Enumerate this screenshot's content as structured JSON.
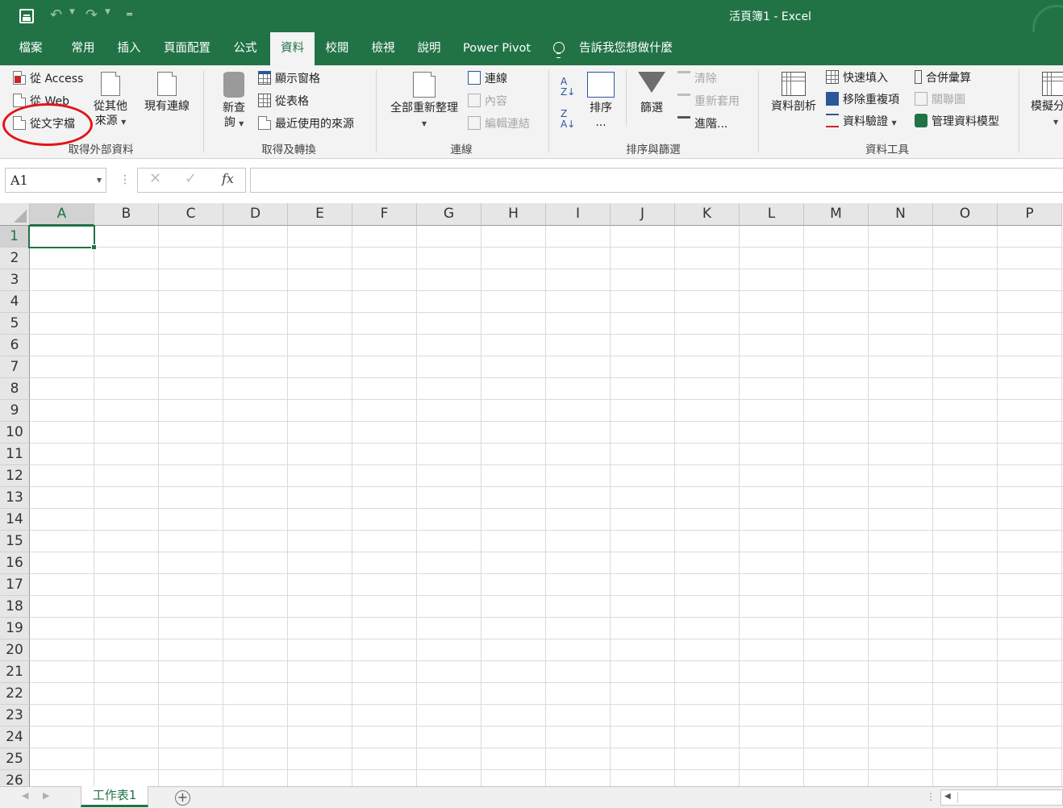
{
  "window": {
    "title": "活頁簿1  -  Excel"
  },
  "qat": {
    "save_icon": "save-icon",
    "undo_icon": "undo-icon",
    "redo_icon": "redo-icon",
    "customize": "="
  },
  "tabs": [
    {
      "label": "檔案"
    },
    {
      "label": "常用"
    },
    {
      "label": "插入"
    },
    {
      "label": "頁面配置"
    },
    {
      "label": "公式"
    },
    {
      "label": "資料",
      "active": true
    },
    {
      "label": "校閱"
    },
    {
      "label": "檢視"
    },
    {
      "label": "說明"
    },
    {
      "label": "Power Pivot"
    }
  ],
  "tell_me": "告訴我您想做什麼",
  "ribbon": {
    "ext": {
      "from_access": "從 Access",
      "from_web": "從 Web",
      "from_text": "從文字檔",
      "from_other_1": "從其他",
      "from_other_2": "來源",
      "existing": "現有連線",
      "label": "取得外部資料"
    },
    "transform": {
      "new_query_1": "新查",
      "new_query_2": "詢",
      "show_queries": "顯示窗格",
      "from_table": "從表格",
      "recent_sources": "最近使用的來源",
      "label": "取得及轉換"
    },
    "connections": {
      "refresh_all": "全部重新整理",
      "connections": "連線",
      "properties": "內容",
      "edit_links": "編輯連結",
      "label": "連線"
    },
    "sort_filter": {
      "sort_1": "排序",
      "sort_2": "...",
      "filter": "篩選",
      "clear": "清除",
      "reapply": "重新套用",
      "advanced": "進階...",
      "label": "排序與篩選"
    },
    "tools": {
      "text_to_columns": "資料剖析",
      "flash_fill": "快速填入",
      "remove_duplicates": "移除重複項",
      "data_validation": "資料驗證",
      "consolidate": "合併彙算",
      "relationships": "關聯圖",
      "manage_model": "管理資料模型",
      "label": "資料工具"
    },
    "forecast": {
      "what_if": "模擬分"
    }
  },
  "formula_bar": {
    "name_box": "A1",
    "cancel": "✕",
    "enter": "✓",
    "fx": "fx",
    "value": ""
  },
  "columns": [
    "A",
    "B",
    "C",
    "D",
    "E",
    "F",
    "G",
    "H",
    "I",
    "J",
    "K",
    "L",
    "M",
    "N",
    "O",
    "P"
  ],
  "rows": [
    "1",
    "2",
    "3",
    "4",
    "5",
    "6",
    "7",
    "8",
    "9",
    "10",
    "11",
    "12",
    "13",
    "14",
    "15",
    "16",
    "17",
    "18",
    "19",
    "20",
    "21",
    "22",
    "23",
    "24",
    "25",
    "26"
  ],
  "selected_cell": "A1",
  "sheets": [
    {
      "name": "工作表1",
      "active": true
    }
  ],
  "colors": {
    "brand": "#217346",
    "annotation": "#e2141b"
  }
}
